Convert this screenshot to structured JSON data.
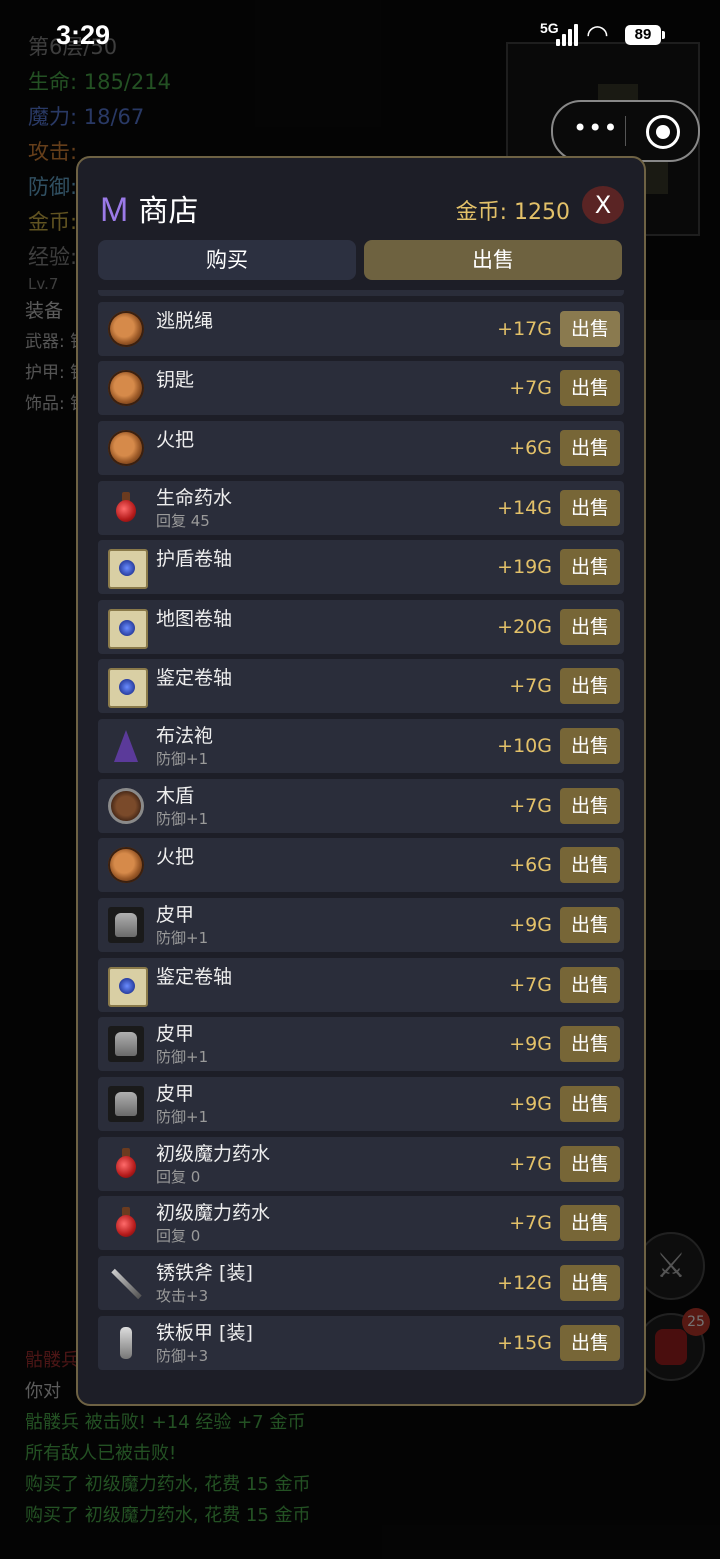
{
  "status_bar": {
    "time": "3:29",
    "network": "5G",
    "battery": "89"
  },
  "hud": {
    "floor": "第6层/50",
    "hp": "生命: 185/214",
    "mp": "魔力: 18/67",
    "atk": "攻击: ",
    "def": "防御: ",
    "gold": "金币: ",
    "exp": "经验: ",
    "level": "Lv.7"
  },
  "equipment": {
    "heading": "装备",
    "weapon": "武器: 锈",
    "armor": "护甲: 铁",
    "accessory": "饰品: 铁"
  },
  "log": [
    {
      "text": "骷髅兵",
      "color": "red"
    },
    {
      "text": "你对",
      "color": "gray"
    },
    {
      "text": "骷髅兵 被击败! +14 经验 +7 金币",
      "color": "green"
    },
    {
      "text": "所有敌人已被击败!",
      "color": "green"
    },
    {
      "text": "购买了 初级魔力药水, 花费 15 金币",
      "color": "green"
    },
    {
      "text": "购买了 初级魔力药水, 花费 15 金币",
      "color": "green"
    }
  ],
  "bag_badge": "25",
  "shop": {
    "logo": "M",
    "title": "商店",
    "gold_label": "金币: 1250",
    "close_label": "X",
    "tabs": {
      "buy": "购买",
      "sell": "出售"
    },
    "sell_label": "出售",
    "items": [
      {
        "icon": "rope-icon",
        "name": "逃脱绳",
        "sub": "",
        "price": "+17G"
      },
      {
        "icon": "rope-icon",
        "name": "钥匙",
        "sub": "",
        "price": "+7G"
      },
      {
        "icon": "rope-icon",
        "name": "火把",
        "sub": "",
        "price": "+6G"
      },
      {
        "icon": "potion-icon",
        "name": "生命药水",
        "sub": "回复 45",
        "price": "+14G"
      },
      {
        "icon": "scroll-icon",
        "name": "护盾卷轴",
        "sub": "",
        "price": "+19G"
      },
      {
        "icon": "scroll-icon",
        "name": "地图卷轴",
        "sub": "",
        "price": "+20G"
      },
      {
        "icon": "scroll-icon",
        "name": "鉴定卷轴",
        "sub": "",
        "price": "+7G"
      },
      {
        "icon": "robe-icon",
        "name": "布法袍",
        "sub": "防御+1",
        "price": "+10G"
      },
      {
        "icon": "shield-icon",
        "name": "木盾",
        "sub": "防御+1",
        "price": "+7G"
      },
      {
        "icon": "rope-icon",
        "name": "火把",
        "sub": "",
        "price": "+6G"
      },
      {
        "icon": "armor-icon",
        "name": "皮甲",
        "sub": "防御+1",
        "price": "+9G"
      },
      {
        "icon": "scroll-icon",
        "name": "鉴定卷轴",
        "sub": "",
        "price": "+7G"
      },
      {
        "icon": "armor-icon",
        "name": "皮甲",
        "sub": "防御+1",
        "price": "+9G"
      },
      {
        "icon": "armor-icon",
        "name": "皮甲",
        "sub": "防御+1",
        "price": "+9G"
      },
      {
        "icon": "potion-icon",
        "name": "初级魔力药水",
        "sub": "回复 0",
        "price": "+7G"
      },
      {
        "icon": "potion-icon",
        "name": "初级魔力药水",
        "sub": "回复 0",
        "price": "+7G"
      },
      {
        "icon": "axe-icon",
        "name": "锈铁斧 [装]",
        "sub": "攻击+3",
        "price": "+12G"
      },
      {
        "icon": "plate-armor-icon",
        "name": "铁板甲 [装]",
        "sub": "防御+3",
        "price": "+15G"
      }
    ]
  }
}
